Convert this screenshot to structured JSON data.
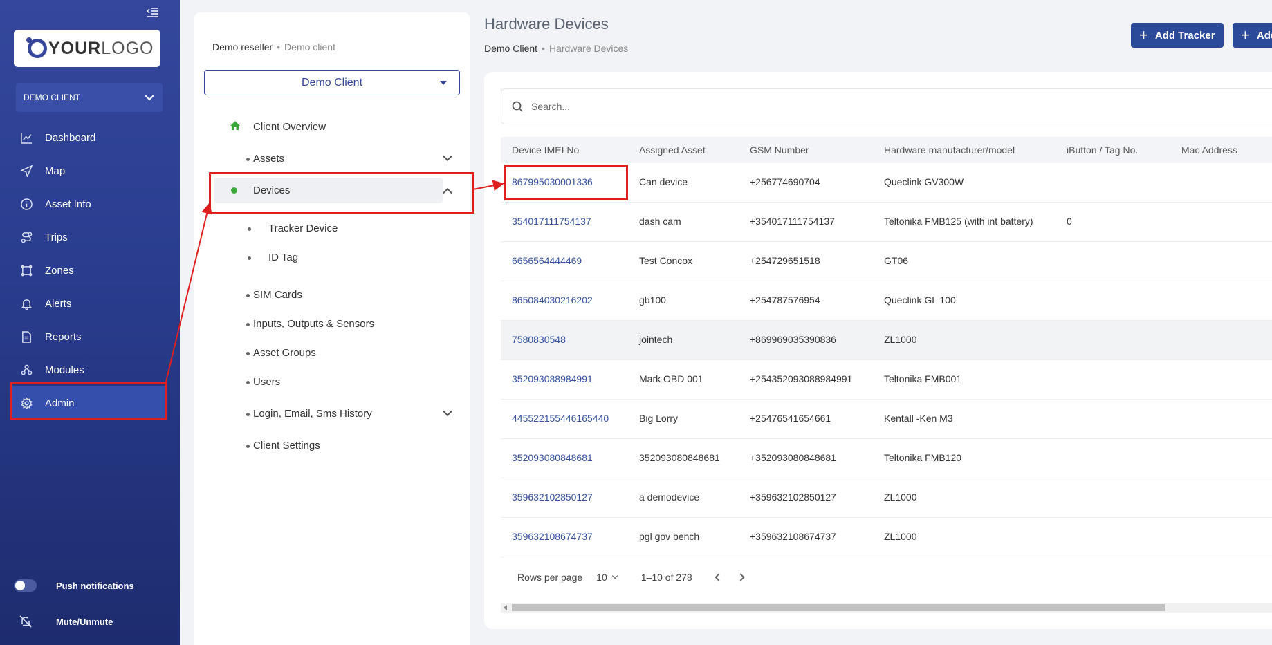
{
  "sidebar": {
    "logo": {
      "part1": "YOUR",
      "part2": "LOGO"
    },
    "client_selector": "DEMO CLIENT",
    "items": [
      {
        "label": "Dashboard",
        "icon": "chart-line-icon"
      },
      {
        "label": "Map",
        "icon": "navigation-arrow-icon"
      },
      {
        "label": "Asset Info",
        "icon": "info-circle-icon"
      },
      {
        "label": "Trips",
        "icon": "route-icon"
      },
      {
        "label": "Zones",
        "icon": "polygon-icon"
      },
      {
        "label": "Alerts",
        "icon": "bell-icon"
      },
      {
        "label": "Reports",
        "icon": "document-icon"
      },
      {
        "label": "Modules",
        "icon": "modules-icon"
      },
      {
        "label": "Admin",
        "icon": "gear-icon"
      }
    ],
    "push_notifications": "Push notifications",
    "mute": "Mute/Unmute"
  },
  "middle": {
    "breadcrumb": {
      "first": "Demo reseller",
      "second": "Demo client"
    },
    "client_dropdown": "Demo Client",
    "menu": {
      "client_overview": "Client Overview",
      "assets": "Assets",
      "devices": "Devices",
      "tracker_device": "Tracker Device",
      "id_tag": "ID Tag",
      "sim_cards": "SIM Cards",
      "inputs_outputs": "Inputs, Outputs & Sensors",
      "asset_groups": "Asset Groups",
      "users": "Users",
      "login_history": "Login, Email, Sms History",
      "client_settings": "Client Settings"
    }
  },
  "main": {
    "title": "Hardware Devices",
    "breadcrumb": {
      "first": "Demo Client",
      "second": "Hardware Devices"
    },
    "add_tracker": "Add Tracker",
    "add_second": "Add",
    "search_placeholder": "Search...",
    "columns": [
      "Device IMEI No",
      "Assigned Asset",
      "GSM Number",
      "Hardware manufacturer/model",
      "iButton / Tag No.",
      "Mac Address"
    ],
    "rows": [
      {
        "imei": "867995030001336",
        "asset": "Can device",
        "gsm": "+256774690704",
        "model": "Queclink GV300W",
        "tag": ""
      },
      {
        "imei": "354017111754137",
        "asset": "dash cam",
        "gsm": "+354017111754137",
        "model": "Teltonika FMB125 (with int battery)",
        "tag": "0"
      },
      {
        "imei": "6656564444469",
        "asset": "Test Concox",
        "gsm": "+254729651518",
        "model": "GT06",
        "tag": ""
      },
      {
        "imei": "865084030216202",
        "asset": "gb100",
        "gsm": "+254787576954",
        "model": "Queclink GL 100",
        "tag": ""
      },
      {
        "imei": "7580830548",
        "asset": "jointech",
        "gsm": "+869969035390836",
        "model": "ZL1000",
        "tag": ""
      },
      {
        "imei": "352093088984991",
        "asset": "Mark OBD 001",
        "gsm": "+254352093088984991",
        "model": "Teltonika FMB001",
        "tag": ""
      },
      {
        "imei": "445522155446165440",
        "asset": "Big Lorry",
        "gsm": "+25476541654661",
        "model": "Kentall -Ken M3",
        "tag": ""
      },
      {
        "imei": "352093080848681",
        "asset": "352093080848681",
        "gsm": "+352093080848681",
        "model": "Teltonika FMB120",
        "tag": ""
      },
      {
        "imei": "359632102850127",
        "asset": "a demodevice",
        "gsm": "+359632102850127",
        "model": "ZL1000",
        "tag": ""
      },
      {
        "imei": "359632108674737",
        "asset": "pgl gov bench",
        "gsm": "+359632108674737",
        "model": "ZL1000",
        "tag": ""
      }
    ],
    "footer": {
      "rows_per_page_label": "Rows per page",
      "rows_per_page": "10",
      "range": "1–10 of 278"
    }
  },
  "colors": {
    "brand": "#2c4a9a",
    "highlight": "#e01e1e",
    "link": "#3451a0"
  }
}
